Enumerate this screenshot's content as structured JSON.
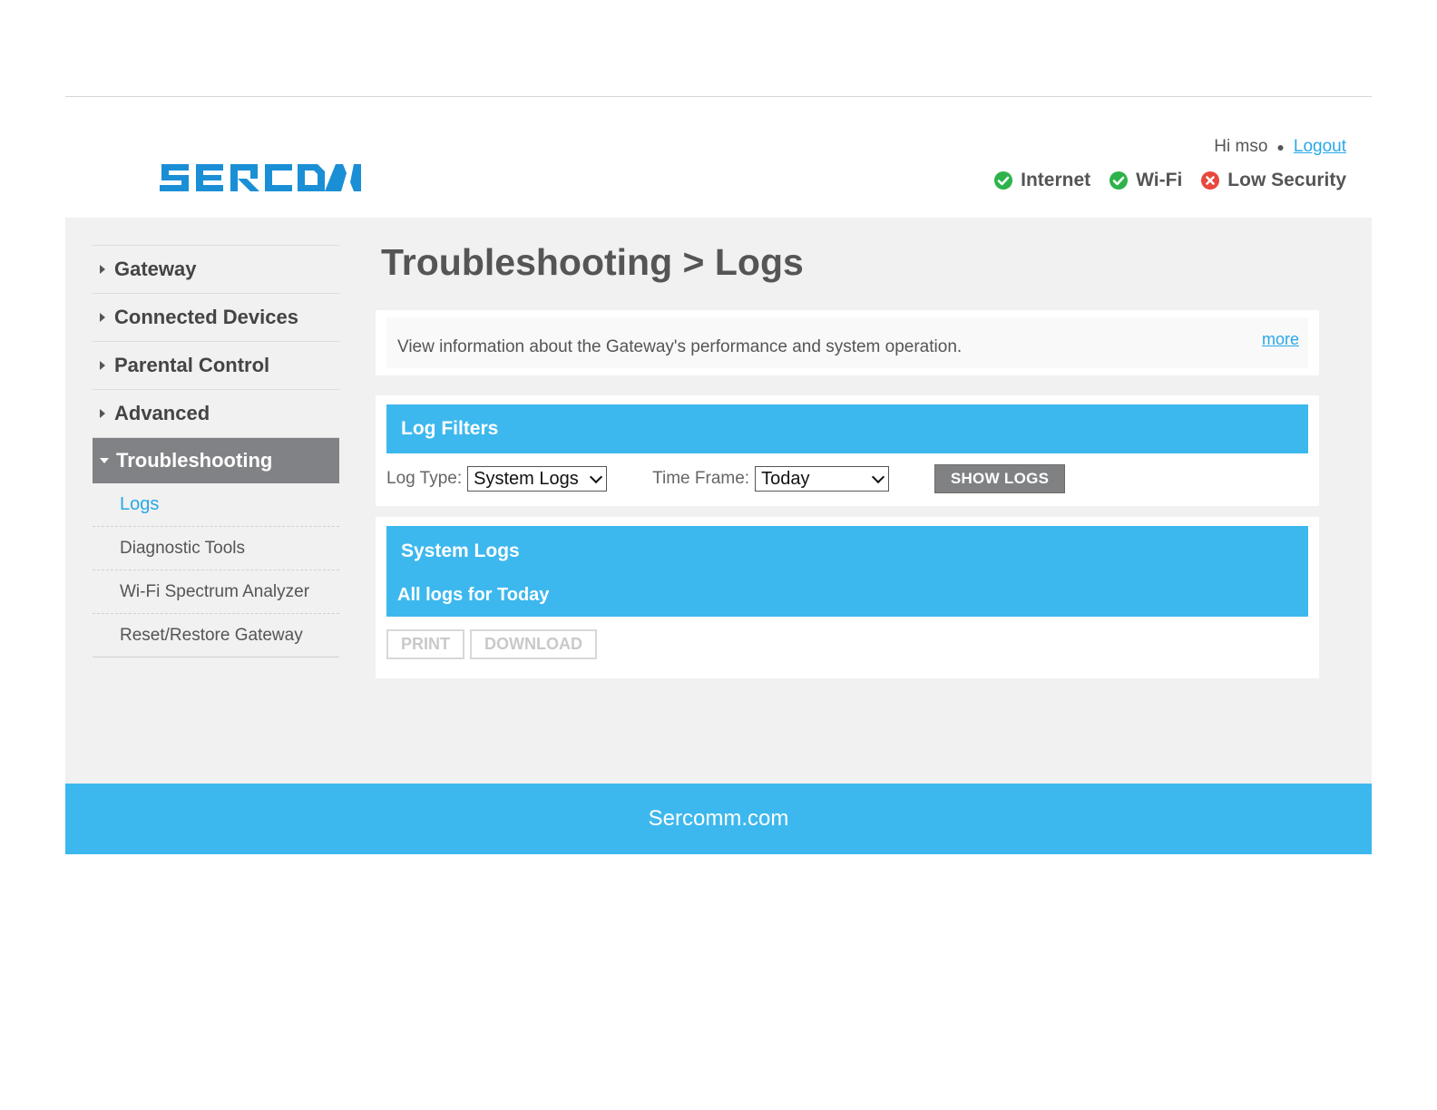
{
  "header": {
    "logo_text": "SERCOMM",
    "greeting": "Hi mso",
    "logout_label": "Logout",
    "status": [
      {
        "label": "Internet",
        "state": "ok",
        "color": "#2db34a"
      },
      {
        "label": "Wi-Fi",
        "state": "ok",
        "color": "#2db34a"
      },
      {
        "label": "Low Security",
        "state": "error",
        "color": "#e8483d"
      }
    ]
  },
  "sidebar": {
    "items": [
      {
        "label": "Gateway"
      },
      {
        "label": "Connected Devices"
      },
      {
        "label": "Parental Control"
      },
      {
        "label": "Advanced"
      },
      {
        "label": "Troubleshooting"
      }
    ],
    "subitems": [
      {
        "label": "Logs"
      },
      {
        "label": "Diagnostic Tools"
      },
      {
        "label": "Wi-Fi Spectrum Analyzer"
      },
      {
        "label": "Reset/Restore Gateway"
      }
    ]
  },
  "main": {
    "title": "Troubleshooting > Logs",
    "info_text": "View information about the Gateway's performance and system operation.",
    "more_label": "more",
    "filters": {
      "header": "Log Filters",
      "log_type_label": "Log Type:",
      "log_type_value": "System Logs",
      "time_frame_label": "Time Frame:",
      "time_frame_value": "Today",
      "show_logs_label": "SHOW LOGS"
    },
    "logs": {
      "header": "System Logs",
      "subheader": "All logs for Today",
      "print_label": "PRINT",
      "download_label": "DOWNLOAD"
    }
  },
  "footer": {
    "text": "Sercomm.com"
  },
  "colors": {
    "accent": "#3db8ee",
    "link": "#29a8e8",
    "active_nav": "#818285",
    "logo": "#1a8fd6"
  }
}
